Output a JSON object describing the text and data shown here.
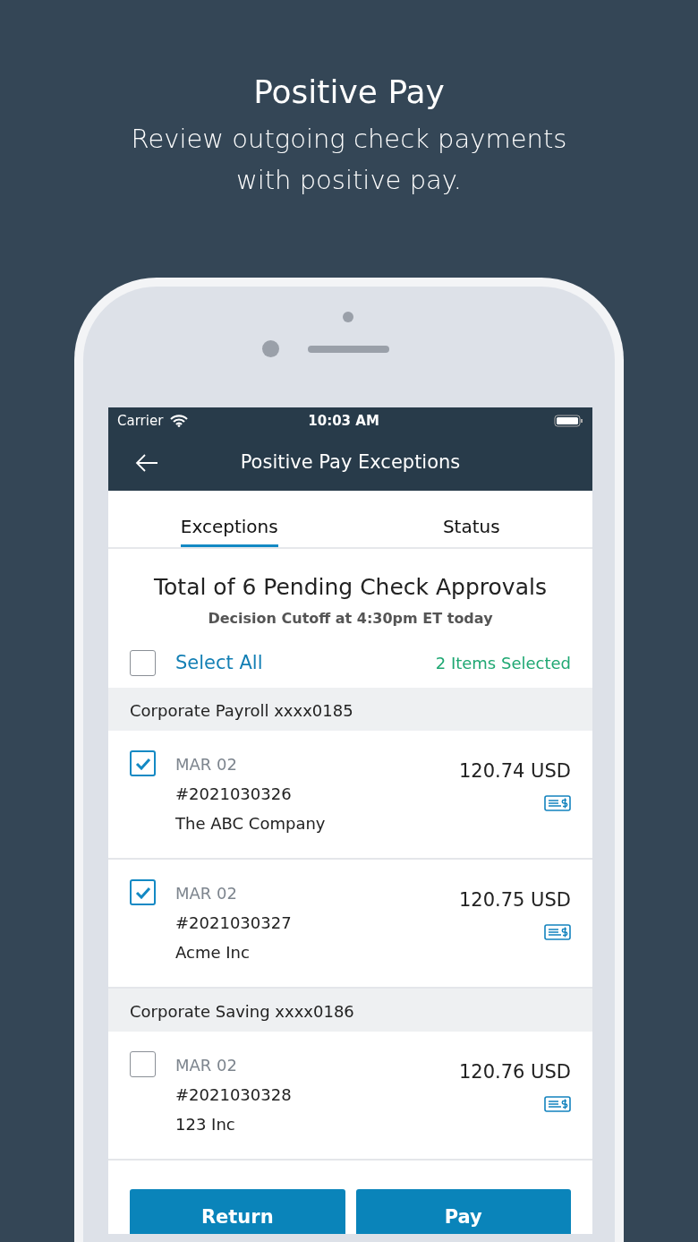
{
  "header": {
    "title": "Positive Pay",
    "subtitle": "Review outgoing check payments with positive pay."
  },
  "status_bar": {
    "carrier": "Carrier",
    "time": "10:03 AM"
  },
  "nav": {
    "title": "Positive Pay Exceptions"
  },
  "tabs": [
    {
      "label": "Exceptions",
      "selected": true
    },
    {
      "label": "Status",
      "selected": false
    }
  ],
  "summary": {
    "title": "Total of 6 Pending Check Approvals",
    "cutoff": "Decision Cutoff at 4:30pm ET today"
  },
  "select_all": {
    "label": "Select All",
    "checked": false,
    "count": "2 Items Selected"
  },
  "accounts": [
    {
      "name": "Corporate Payroll xxxx0185",
      "checks": [
        {
          "date": "MAR 02",
          "number": "#2021030326",
          "payee": "The ABC Company",
          "amount": "120.74 USD",
          "checked": true
        },
        {
          "date": "MAR 02",
          "number": "#2021030327",
          "payee": "Acme Inc",
          "amount": "120.75 USD",
          "checked": true
        }
      ]
    },
    {
      "name": "Corporate Saving xxxx0186",
      "checks": [
        {
          "date": "MAR 02",
          "number": "#2021030328",
          "payee": "123 Inc",
          "amount": "120.76 USD",
          "checked": false
        }
      ]
    }
  ],
  "buttons": [
    "Return",
    "Pay"
  ]
}
